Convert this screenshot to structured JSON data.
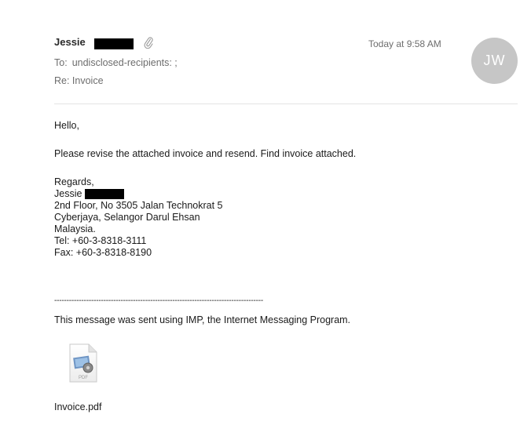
{
  "header": {
    "sender_name": "Jessie",
    "timestamp": "Today at 9:58 AM",
    "avatar_initials": "JW",
    "to_label": "To:",
    "to_value": "undisclosed-recipients: ;",
    "subject": "Re: Invoice"
  },
  "body": {
    "greeting": "Hello,",
    "request": "Please revise the attached invoice and resend. Find invoice attached.",
    "signature": {
      "regards": "Regards,",
      "name": "Jessie",
      "address_1": "2nd Floor, No 3505 Jalan Technokrat 5",
      "address_2": "Cyberjaya, Selangor Darul Ehsan",
      "address_3": "Malaysia.",
      "tel": "Tel: +60-3-8318-3111",
      "fax": "Fax: +60-3-8318-8190"
    },
    "separator": "-------------------------------------------------------------------------------------",
    "footer": "This message was sent using IMP, the Internet Messaging Program."
  },
  "attachment": {
    "filename": "Invoice.pdf",
    "icon_label": "PDF",
    "icon": "pdf-file-icon"
  },
  "colors": {
    "avatar_bg": "#c6c6c6",
    "meta_text": "#6d6d6d",
    "redaction": "#000000"
  }
}
